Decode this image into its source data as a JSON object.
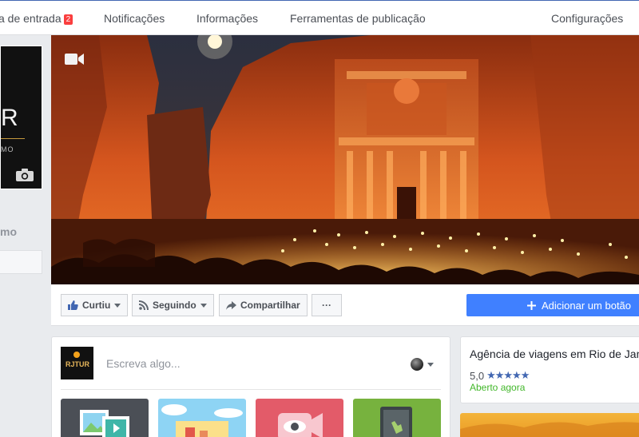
{
  "tabs": {
    "inbox": "a de entrada",
    "inbox_badge": "2",
    "notifications": "Notificações",
    "info": "Informações",
    "publishing_tools": "Ferramentas de publicação",
    "settings": "Configurações"
  },
  "profile": {
    "logo_letter": "R",
    "logo_sub": "MO",
    "page_name_fragment": "mo"
  },
  "actions": {
    "liked": "Curtiu",
    "following": "Seguindo",
    "share": "Compartilhar",
    "more": "···",
    "add_button": "Adicionar um botão"
  },
  "composer": {
    "placeholder": "Escreva algo...",
    "avatar_text": "RJTUR"
  },
  "info_card": {
    "category": "Agência de viagens em Rio de Jan",
    "rating": "5,0",
    "stars": "★★★★★",
    "status": "Aberto agora"
  },
  "colors": {
    "brand_blue": "#4267b2",
    "button_blue": "#4080ff",
    "open_green": "#42b72a",
    "badge_red": "#fa3e3e"
  },
  "icons": {
    "video": "video-camera-icon",
    "camera": "camera-icon",
    "like": "thumbs-up-icon",
    "follow": "rss-icon",
    "share": "share-arrow-icon",
    "add": "plus-icon"
  }
}
